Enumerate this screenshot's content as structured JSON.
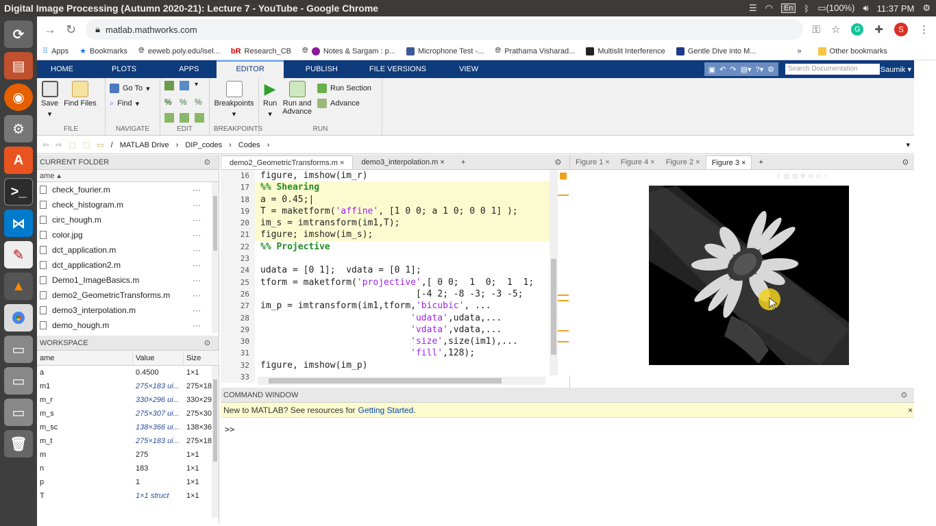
{
  "window_title": "Digital Image Processing (Autumn 2020-21): Lecture 7 - YouTube - Google Chrome",
  "tray": {
    "lang": "En",
    "battery": "(100%)",
    "time": "11:37 PM"
  },
  "browser": {
    "url": "matlab.mathworks.com",
    "avatar_letter": "S",
    "bookmarks": [
      "Apps",
      "Bookmarks",
      "eeweb.poly.edu/isel...",
      "Research_CB",
      "Notes & Sargam : p...",
      "Microphone Test -...",
      "Prathama Visharad...",
      "Multislit Interference",
      "Gentle Dive into M..."
    ],
    "overflow": "»",
    "other_bookmarks": "Other bookmarks"
  },
  "matlab": {
    "tabs": [
      "HOME",
      "PLOTS",
      "APPS",
      "EDITOR",
      "PUBLISH",
      "FILE VERSIONS",
      "VIEW"
    ],
    "active_tab": "EDITOR",
    "search_placeholder": "Search Documentation",
    "user": "Saumik",
    "ribbon": {
      "file": {
        "caption": "FILE",
        "save": "Save",
        "find_files": "Find Files"
      },
      "navigate": {
        "caption": "NAVIGATE",
        "goto": "Go To",
        "find": "Find"
      },
      "edit": {
        "caption": "EDIT"
      },
      "breakpoints": {
        "caption": "BREAKPOINTS",
        "label": "Breakpoints"
      },
      "run": {
        "caption": "RUN",
        "run": "Run",
        "run_advance": "Run and\nAdvance",
        "run_section": "Run Section",
        "advance": "Advance"
      }
    },
    "path": [
      "/",
      "MATLAB Drive",
      "DIP_codes",
      "Codes"
    ],
    "current_folder": {
      "title": "CURRENT FOLDER",
      "col": "ame",
      "files": [
        "check_fourier.m",
        "check_histogram.m",
        "circ_hough.m",
        "color.jpg",
        "dct_application.m",
        "dct_application2.m",
        "Demo1_ImageBasics.m",
        "demo2_GeometricTransforms.m",
        "demo3_interpolation.m",
        "demo_hough.m"
      ]
    },
    "workspace": {
      "title": "WORKSPACE",
      "cols": [
        "ame",
        "Value",
        "Size"
      ],
      "rows": [
        {
          "name": "a",
          "value": "0.4500",
          "size": "1×1",
          "italic": false
        },
        {
          "name": "m1",
          "value": "275×183 ui...",
          "size": "275×18",
          "italic": true
        },
        {
          "name": "m_r",
          "value": "330×296 ui...",
          "size": "330×29",
          "italic": true
        },
        {
          "name": "m_s",
          "value": "275×307 ui...",
          "size": "275×30",
          "italic": true
        },
        {
          "name": "m_sc",
          "value": "138×366 ui...",
          "size": "138×36",
          "italic": true
        },
        {
          "name": "m_t",
          "value": "275×183 ui...",
          "size": "275×18",
          "italic": true
        },
        {
          "name": "m",
          "value": "275",
          "size": "1×1",
          "italic": false
        },
        {
          "name": "n",
          "value": "183",
          "size": "1×1",
          "italic": false
        },
        {
          "name": "p",
          "value": "1",
          "size": "1×1",
          "italic": false
        },
        {
          "name": "T",
          "value": "1×1 struct",
          "size": "1×1",
          "italic": true
        }
      ]
    },
    "editor": {
      "tabs": [
        "demo2_GeometricTransforms.m",
        "demo3_interpolation.m"
      ],
      "lines": [
        {
          "n": "16",
          "html": "figure, imshow(im_r)",
          "hl": false
        },
        {
          "n": "17",
          "html": "<span class=\"cm\">%% Shearing</span>",
          "hl": true
        },
        {
          "n": "18",
          "html": "a = 0.45;|",
          "hl": true
        },
        {
          "n": "19",
          "html": "T = maketform(<span class=\"st\">'affine'</span>, [1 0 0; a 1 0; 0 0 1] );",
          "hl": true
        },
        {
          "n": "20",
          "html": "im_s = imtransform(im1,T);",
          "hl": true
        },
        {
          "n": "21",
          "html": "figure; imshow(im_s);",
          "hl": true
        },
        {
          "n": "22",
          "html": "<span class=\"cm\">%% Projective</span>",
          "hl": false
        },
        {
          "n": "23",
          "html": "",
          "hl": false
        },
        {
          "n": "24",
          "html": "udata = [0 1];  vdata = [0 1];",
          "hl": false
        },
        {
          "n": "25",
          "html": "tform = maketform(<span class=\"st\">'projective'</span>,[ 0 0;  1  0;  1  1;",
          "hl": false
        },
        {
          "n": "26",
          "html": "                             [-4 2; -8 -3; -3 -5;",
          "hl": false
        },
        {
          "n": "27",
          "html": "im_p = imtransform(im1,tform,<span class=\"st\">'bicubic'</span>, ...",
          "hl": false
        },
        {
          "n": "28",
          "html": "                            <span class=\"st\">'udata'</span>,udata,...",
          "hl": false
        },
        {
          "n": "29",
          "html": "                            <span class=\"st\">'vdata'</span>,vdata,...",
          "hl": false
        },
        {
          "n": "30",
          "html": "                            <span class=\"st\">'size'</span>,size(im1),...",
          "hl": false
        },
        {
          "n": "31",
          "html": "                            <span class=\"st\">'fill'</span>,128);",
          "hl": false
        },
        {
          "n": "32",
          "html": "figure, imshow(im_p)",
          "hl": false
        },
        {
          "n": "33",
          "html": "",
          "hl": false
        }
      ]
    },
    "figures": {
      "tabs": [
        "Figure 1",
        "Figure 4",
        "Figure 2",
        "Figure 3"
      ],
      "active": "Figure 3"
    },
    "command": {
      "title": "COMMAND WINDOW",
      "notice": "New to MATLAB? See resources for",
      "link": "Getting Started",
      "notice_end": ".",
      "prompt": ">>"
    }
  }
}
